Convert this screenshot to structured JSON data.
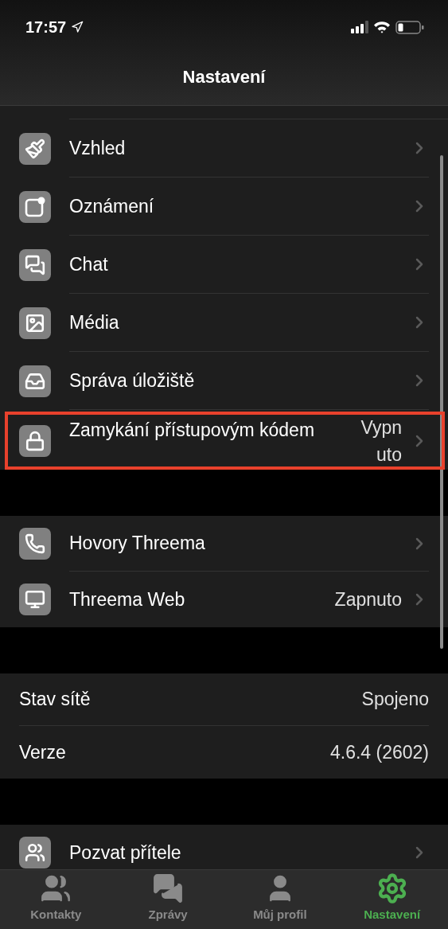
{
  "status_bar": {
    "time": "17:57"
  },
  "nav_bar": {
    "title": "Nastavení"
  },
  "sections": [
    {
      "items": [
        {
          "kind": "nav",
          "label": "Vzhled",
          "highlighted": false
        },
        {
          "kind": "nav",
          "label": "Oznámení",
          "highlighted": false
        },
        {
          "kind": "nav",
          "label": "Chat",
          "highlighted": false
        },
        {
          "kind": "nav",
          "label": "Média",
          "highlighted": false
        },
        {
          "kind": "nav",
          "label": "Správa úložiště",
          "highlighted": false
        },
        {
          "kind": "nav",
          "label": "Zamykání přístupovým kódem",
          "value": "Vypnuto",
          "highlighted": true
        }
      ]
    },
    {
      "items": [
        {
          "kind": "nav",
          "label": "Hovory Threema",
          "highlighted": false
        },
        {
          "kind": "nav",
          "label": "Threema Web",
          "value": "Zapnuto",
          "highlighted": false
        }
      ]
    },
    {
      "items": [
        {
          "kind": "info",
          "label": "Stav sítě",
          "value": "Spojeno"
        },
        {
          "kind": "info",
          "label": "Verze",
          "value": "4.6.4 (2602)"
        }
      ]
    },
    {
      "items": [
        {
          "kind": "nav",
          "label": "Pozvat přítele",
          "highlighted": false
        }
      ]
    }
  ],
  "tab_bar": [
    {
      "label": "Kontakty",
      "selected": false
    },
    {
      "label": "Zprávy",
      "selected": false
    },
    {
      "label": "Můj profil",
      "selected": false
    },
    {
      "label": "Nastavení",
      "selected": true
    }
  ]
}
